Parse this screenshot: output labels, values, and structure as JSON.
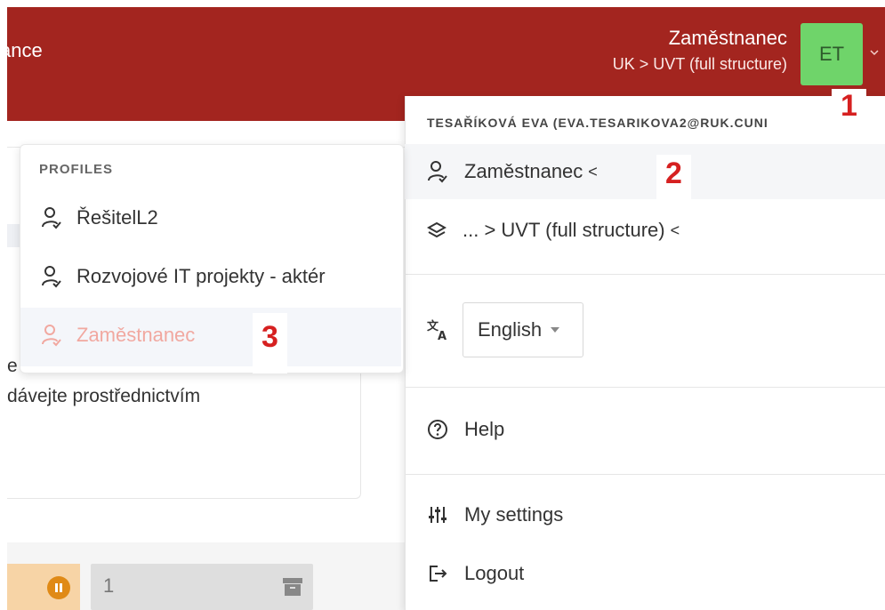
{
  "header": {
    "left_text": "ance",
    "user_role": "Zaměstnanec",
    "user_org": "UK > UVT (full structure)",
    "avatar_initials": "ET",
    "bg_color": "#a3251f",
    "avatar_color": "#6fd46a"
  },
  "background": {
    "text_line_1": "e",
    "text_line_2": "dávejte prostřednictvím",
    "input_value": "1"
  },
  "dropdown": {
    "user_email": "TESAŘÍKOVÁ EVA (EVA.TESARIKOVA2@RUK.CUNI",
    "profile_label": "Zaměstnanec",
    "org_label": "... > UVT (full structure)",
    "chevron": "<",
    "language": "English",
    "help_label": "Help",
    "settings_label": "My settings",
    "logout_label": "Logout"
  },
  "profiles": {
    "heading": "PROFILES",
    "items": [
      {
        "label": "ŘešitelL2"
      },
      {
        "label": "Rozvojové IT projekty - aktér"
      },
      {
        "label": "Zaměstnanec",
        "active": true
      }
    ]
  },
  "annotations": [
    "1",
    "2",
    "3"
  ],
  "colors": {
    "annotation": "#d62020",
    "active_profile": "#f1a8a0"
  }
}
